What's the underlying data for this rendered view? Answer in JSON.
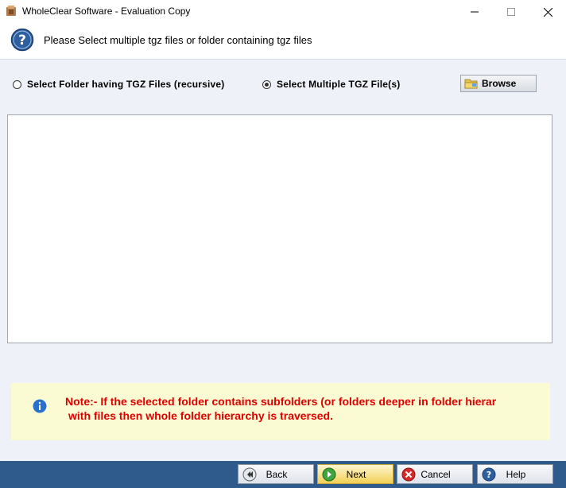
{
  "window": {
    "title": "WholeClear Software - Evaluation Copy",
    "controls": [
      "minimize",
      "maximize",
      "close"
    ]
  },
  "header": {
    "instruction": "Please Select multiple tgz files or folder containing tgz files"
  },
  "options": {
    "folder_label": "Select Folder having TGZ Files (recursive)",
    "files_label": "Select Multiple TGZ File(s)",
    "selected": "files",
    "browse_label": "Browse"
  },
  "file_list": {
    "items": []
  },
  "note": {
    "line1": "Note:- If the selected folder contains subfolders (or folders deeper in folder hierar",
    "line2": "with files then whole folder hierarchy is traversed."
  },
  "buttons": {
    "back": "Back",
    "next": "Next",
    "cancel": "Cancel",
    "help": "Help"
  },
  "colors": {
    "bottom_bar": "#2f5a8c",
    "note_background": "#fbfbd3",
    "note_text": "#e00000"
  }
}
